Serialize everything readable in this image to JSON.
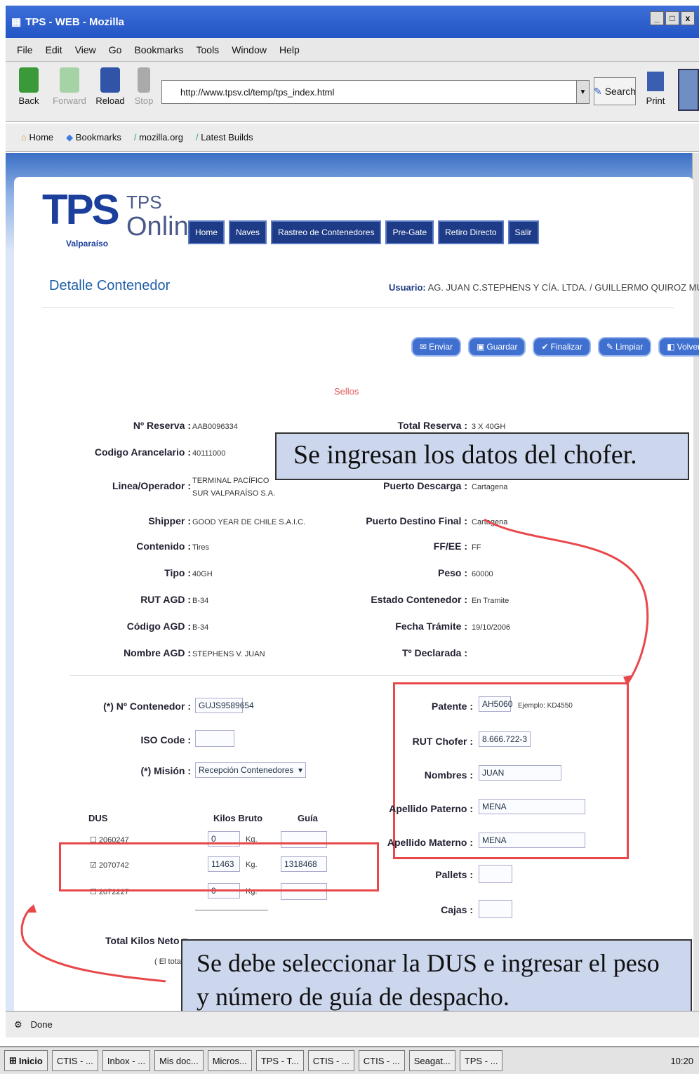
{
  "window": {
    "title": "TPS - WEB - Mozilla",
    "controls": [
      "_",
      "□",
      "x"
    ]
  },
  "menubar": [
    "File",
    "Edit",
    "View",
    "Go",
    "Bookmarks",
    "Tools",
    "Window",
    "Help"
  ],
  "nav": {
    "back": "Back",
    "forward": "Forward",
    "reload": "Reload",
    "stop": "Stop",
    "url": "http://www.tpsv.cl/temp/tps_index.html",
    "search": "Search",
    "print": "Print"
  },
  "bookmarks": [
    "Home",
    "Bookmarks",
    "mozilla.org",
    "Latest Builds"
  ],
  "site": {
    "logo": "TPS",
    "logo_sub": "Valparaíso",
    "online_a": "TPS",
    "online_b": "Online",
    "menu": [
      "Home",
      "Naves",
      "Rastreo de Contenedores",
      "Pre-Gate",
      "Retiro Directo",
      "Salir"
    ],
    "page_title": "Detalle Contenedor",
    "user_label": "Usuario:",
    "user_value": "AG. JUAN C.STEPHENS Y CÍA. LTDA. / GUILLERMO QUIROZ MUÑOZ",
    "actions": [
      "Enviar",
      "Guardar",
      "Finalizar",
      "Limpiar",
      "Volver"
    ],
    "sellos": "Sellos"
  },
  "details_left": [
    {
      "label": "Nº Reserva :",
      "value": "AAB0096334"
    },
    {
      "label": "Codigo Arancelario :",
      "value": "40111000"
    },
    {
      "label": "Linea/Operador :",
      "value": "TERMINAL PACÍFICO SUR VALPARAÍSO S.A."
    },
    {
      "label": "Shipper :",
      "value": "GOOD YEAR DE CHILE S.A.I.C."
    },
    {
      "label": "Contenido :",
      "value": "Tires"
    },
    {
      "label": "Tipo :",
      "value": "40GH"
    },
    {
      "label": "RUT AGD :",
      "value": "B-34"
    },
    {
      "label": "Código AGD :",
      "value": "B-34"
    },
    {
      "label": "Nombre AGD :",
      "value": "STEPHENS V. JUAN"
    }
  ],
  "details_right": [
    {
      "label": "Total Reserva :",
      "value": "3 X 40GH"
    },
    {
      "label": "Puerto Descarga :",
      "value": "Cartagena"
    },
    {
      "label": "Puerto Destino Final :",
      "value": "Cartagena"
    },
    {
      "label": "FF/EE :",
      "value": "FF"
    },
    {
      "label": "Peso :",
      "value": "60000"
    },
    {
      "label": "Estado Contenedor :",
      "value": "En Tramite"
    },
    {
      "label": "Fecha Trámite :",
      "value": "19/10/2006"
    },
    {
      "label": "Tº Declarada :",
      "value": ""
    }
  ],
  "form": {
    "contenedor_label": "(*) Nº Contenedor :",
    "contenedor": "GUJS9589654",
    "iso_label": "ISO Code :",
    "iso": "",
    "mision_label": "(*) Misión :",
    "mision": "Recepción Contenedores",
    "dus_header": "DUS",
    "kilos_header": "Kilos Bruto",
    "guia_header": "Guía",
    "dus_rows": [
      {
        "dus": "2060247",
        "kilos": "0",
        "unit": "Kg.",
        "guia": "",
        "checked": false
      },
      {
        "dus": "2070742",
        "kilos": "11463",
        "unit": "Kg.",
        "guia": "1318468",
        "checked": true
      },
      {
        "dus": "2072227",
        "kilos": "0",
        "unit": "Kg.",
        "guia": "",
        "checked": false
      }
    ],
    "total_label": "Total Kilos Neto =",
    "total_note": "( El total n"
  },
  "driver": {
    "patente_label": "Patente :",
    "patente": "AH5060",
    "ejemplo": "Ejemplo: KD4550",
    "rut_label": "RUT Chofer :",
    "rut": "8.666.722-3",
    "nombres_label": "Nombres :",
    "nombres": "JUAN",
    "paterno_label": "Apellido Paterno :",
    "paterno": "MENA",
    "materno_label": "Apellido Materno :",
    "materno": "MENA",
    "pallets_label": "Pallets :",
    "cajas_label": "Cajas :"
  },
  "annotations": {
    "top": "Se ingresan los datos del chofer.",
    "bottom": "Se debe seleccionar la DUS e ingresar el peso y número de guía de despacho."
  },
  "status": "Done",
  "taskbar": {
    "start": "Inicio",
    "tasks": [
      "CTIS - ...",
      "Inbox - ...",
      "Mis doc...",
      "Micros...",
      "TPS - T...",
      "CTIS - ...",
      "CTIS - ...",
      "Seagat...",
      "TPS - ..."
    ],
    "clock": "10:20"
  }
}
